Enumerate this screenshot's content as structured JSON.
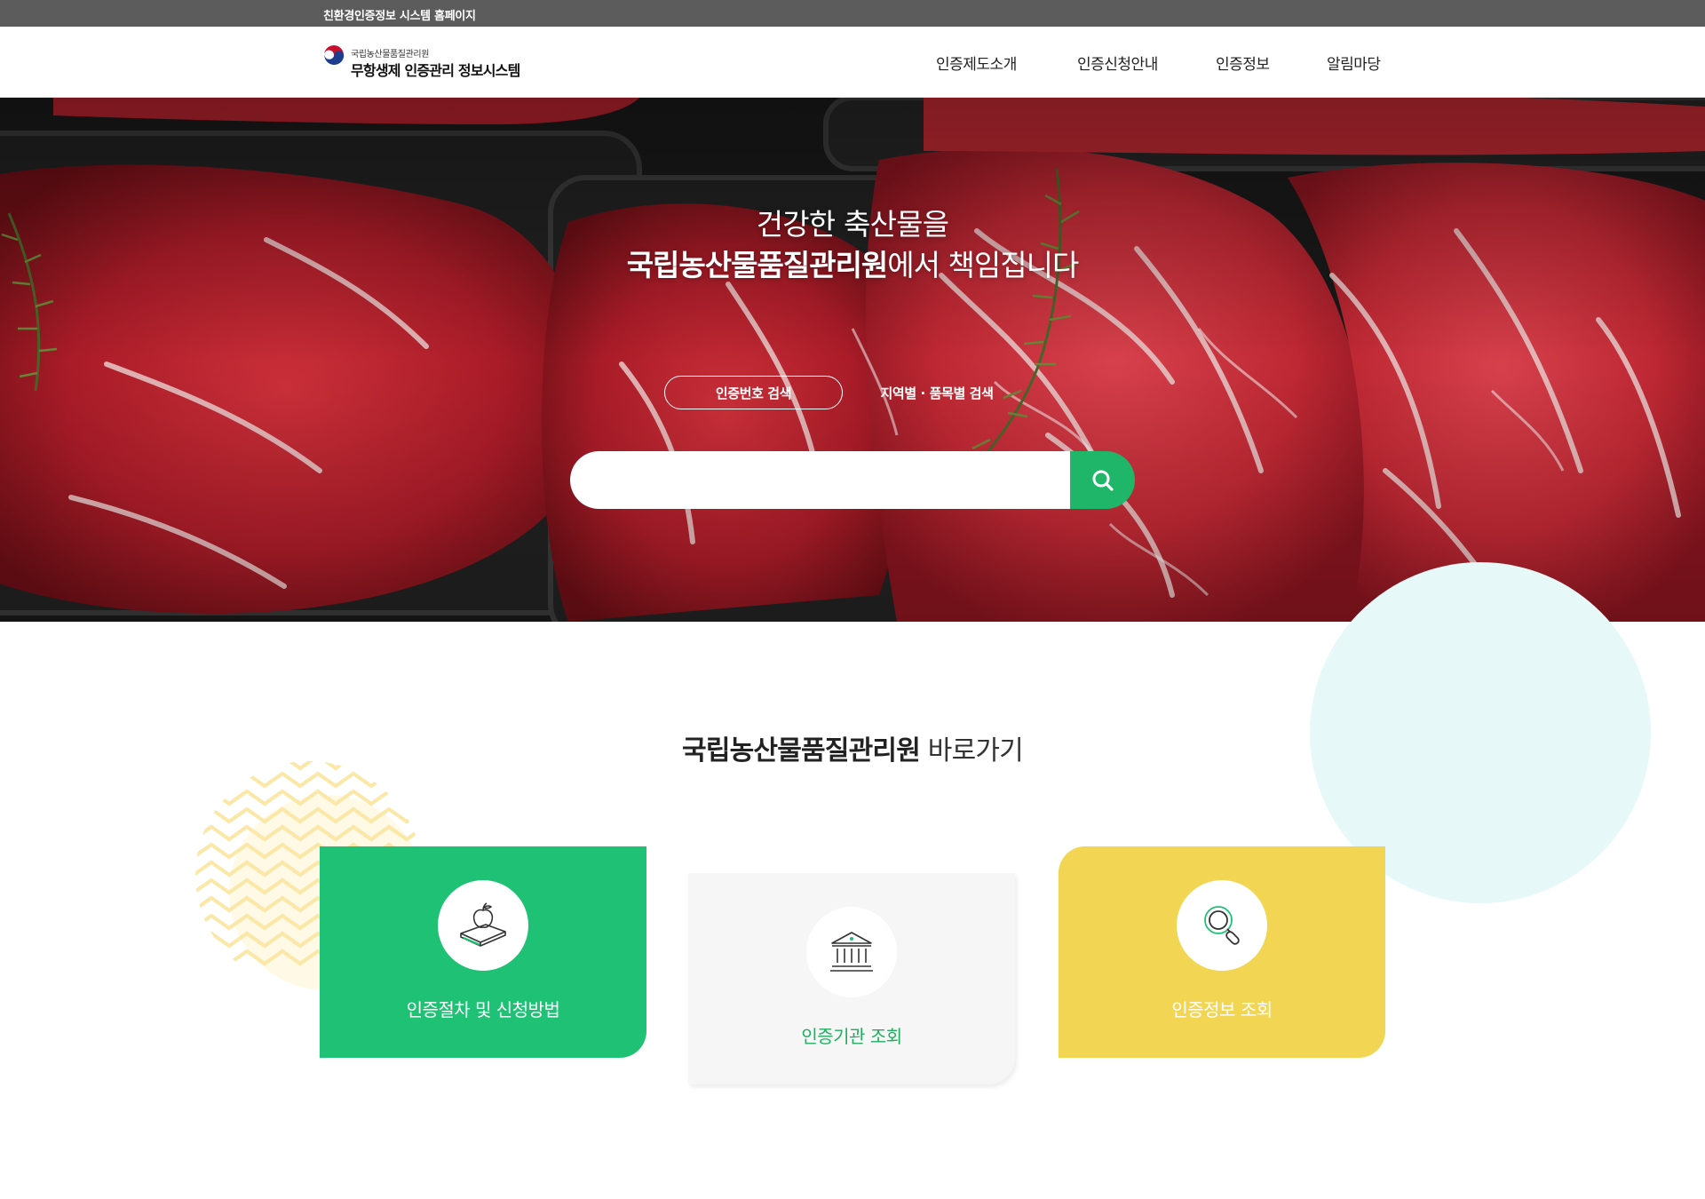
{
  "topbar": {
    "text": "친환경인증정보 시스템 홈페이지"
  },
  "logo": {
    "sub": "국립농산물품질관리원",
    "main": "무항생제 인증관리 정보시스템"
  },
  "nav": {
    "items": [
      "인증제도소개",
      "인증신청안내",
      "인증정보",
      "알림마당"
    ]
  },
  "hero": {
    "line1": "건강한 축산물을",
    "line2_bold": "국립농산물품질관리원",
    "line2_rest": "에서 책임집니다",
    "search_tabs": [
      "인증번호 검색",
      "지역별 · 품목별 검색"
    ],
    "search_value": "",
    "colors": {
      "accent": "#20b66a"
    }
  },
  "shortcuts": {
    "title_bold": "국립농산물품질관리원",
    "title_rest": " 바로가기",
    "cards": [
      {
        "label": "인증절차 및 신청방법",
        "icon": "apple-book-icon",
        "color": "#1fc275"
      },
      {
        "label": "인증기관 조회",
        "icon": "institution-building-icon",
        "color": "#f6f6f6"
      },
      {
        "label": "인증정보 조회",
        "icon": "magnifier-icon",
        "color": "#f2d653"
      }
    ]
  }
}
